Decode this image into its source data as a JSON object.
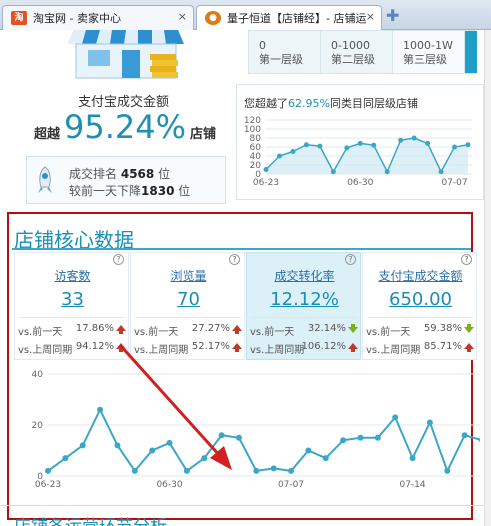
{
  "tabs": [
    {
      "label": "淘宝网 - 卖家中心",
      "icon": "taobao-icon",
      "close": "×"
    },
    {
      "label": "量子恒道【店铺经】- 店铺运",
      "icon": "liangzi-icon",
      "close": "×"
    }
  ],
  "summary": {
    "pay_label": "支付宝成交金额",
    "beyond_prefix": "超越",
    "beyond_pct": "95.24%",
    "beyond_suffix": "店铺",
    "rank_label": "成交排名",
    "rank_value": "4568",
    "rank_unit": "位",
    "rank_change_label": "较前一天下降",
    "rank_change_value": "1830",
    "rank_change_unit": "位"
  },
  "levels": [
    {
      "range": "0",
      "name": "第一层级"
    },
    {
      "range": "0-1000",
      "name": "第二层级"
    },
    {
      "range": "1000-1W",
      "name": "第三层级"
    }
  ],
  "exceed": {
    "prefix": "您超越了",
    "pct": "62.95%",
    "suffix": "同类目同层级店铺"
  },
  "core": {
    "title": "店铺核心数据"
  },
  "metrics": [
    {
      "label": "访客数",
      "value": "33",
      "rows": [
        {
          "cmp": "vs.前一天",
          "num": "17.86%",
          "dir": "up"
        },
        {
          "cmp": "vs.上周同期",
          "num": "94.12%",
          "dir": "up"
        }
      ]
    },
    {
      "label": "浏览量",
      "value": "70",
      "rows": [
        {
          "cmp": "vs.前一天",
          "num": "27.27%",
          "dir": "up"
        },
        {
          "cmp": "vs.上周同期",
          "num": "52.17%",
          "dir": "up"
        }
      ]
    },
    {
      "label": "成交转化率",
      "value": "12.12%",
      "rows": [
        {
          "cmp": "vs.前一天",
          "num": "32.14%",
          "dir": "down"
        },
        {
          "cmp": "vs.上周同期",
          "num": "106.12%",
          "dir": "up"
        }
      ]
    },
    {
      "label": "支付宝成交金额",
      "value": "650.00",
      "rows": [
        {
          "cmp": "vs.前一天",
          "num": "59.38%",
          "dir": "down"
        },
        {
          "cmp": "vs.上周同期",
          "num": "85.71%",
          "dir": "up"
        }
      ]
    }
  ],
  "help_mark": "?",
  "bottom_title": "店铺各运营环节分析",
  "colors": {
    "accent": "#1a8fb6",
    "red_box": "#b40f0f",
    "up": "#c0392b",
    "down": "#7ab317"
  },
  "chart_data": [
    {
      "type": "line",
      "x": [
        "06-23",
        "06-24",
        "06-25",
        "06-26",
        "06-27",
        "06-28",
        "06-29",
        "06-30",
        "07-01",
        "07-02",
        "07-03",
        "07-04",
        "07-05",
        "07-06",
        "07-07",
        "07-08"
      ],
      "y_ticks": [
        0,
        20,
        40,
        60,
        80,
        100,
        120
      ],
      "x_ticks": [
        "06-23",
        "06-30",
        "07-07"
      ],
      "ylim": [
        0,
        120
      ],
      "series": [
        {
          "values": [
            10,
            40,
            50,
            65,
            62,
            5,
            58,
            68,
            64,
            5,
            75,
            80,
            68,
            5,
            60,
            65
          ]
        }
      ]
    },
    {
      "type": "line",
      "x": [
        "06-23",
        "06-24",
        "06-25",
        "06-26",
        "06-27",
        "06-28",
        "06-29",
        "06-30",
        "07-01",
        "07-02",
        "07-03",
        "07-04",
        "07-05",
        "07-06",
        "07-07",
        "07-08",
        "07-09",
        "07-10",
        "07-11",
        "07-12",
        "07-13",
        "07-14",
        "07-15",
        "07-16",
        "07-17",
        "07-18"
      ],
      "y_ticks": [
        0,
        20,
        40
      ],
      "x_ticks": [
        "06-23",
        "06-30",
        "07-07",
        "07-14"
      ],
      "ylim": [
        0,
        40
      ],
      "series": [
        {
          "values": [
            2,
            7,
            12,
            26,
            12,
            2,
            10,
            13,
            2,
            7,
            16,
            15,
            2,
            3,
            2,
            10,
            7,
            14,
            15,
            15,
            23,
            7,
            21,
            2,
            16,
            14
          ]
        }
      ]
    }
  ]
}
